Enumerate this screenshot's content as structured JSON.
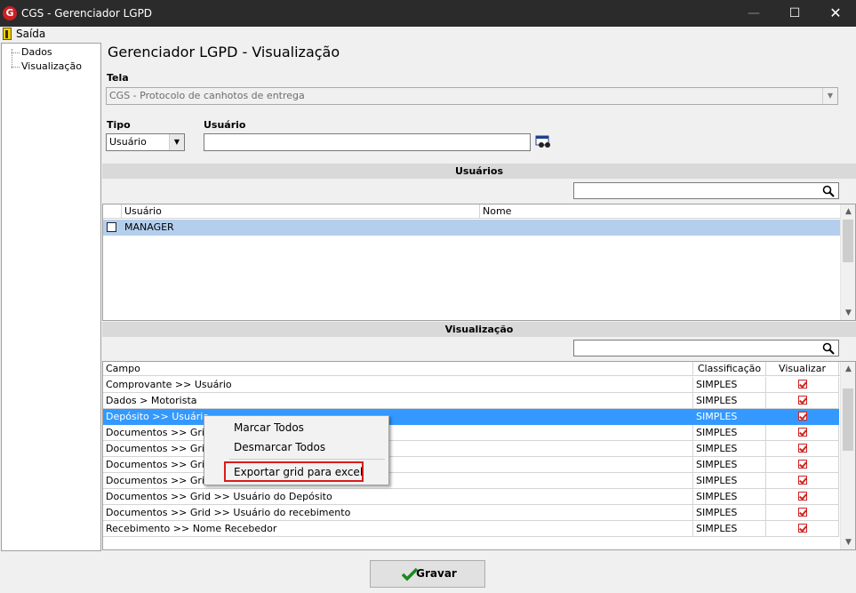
{
  "window": {
    "title": "CGS - Gerenciador LGPD",
    "app_icon_letter": "G",
    "minimize": "—",
    "maximize": "☐",
    "close": "✕"
  },
  "menu": {
    "saida": "Saída"
  },
  "tree": {
    "items": [
      "Dados",
      "Visualização"
    ]
  },
  "page_title": "Gerenciador LGPD - Visualização",
  "tela": {
    "label": "Tela",
    "value": "CGS - Protocolo de canhotos de entrega"
  },
  "tipo": {
    "label": "Tipo",
    "value": "Usuário"
  },
  "usuario": {
    "label": "Usuário",
    "value": ""
  },
  "usuarios_section": {
    "header": "Usuários",
    "search_value": "",
    "columns": [
      "Usuário",
      "Nome"
    ],
    "rows": [
      {
        "usuario": "MANAGER",
        "nome": ""
      }
    ]
  },
  "visualizacao_section": {
    "header": "Visualização",
    "search_value": "",
    "columns": [
      "Campo",
      "Classificação",
      "Visualizar"
    ],
    "rows": [
      {
        "campo": "Comprovante >> Usuário",
        "classificacao": "SIMPLES"
      },
      {
        "campo": "Dados > Motorista",
        "classificacao": "SIMPLES"
      },
      {
        "campo": "Depósito >> Usuário",
        "classificacao": "SIMPLES"
      },
      {
        "campo": "Documentos >> Grid >>",
        "classificacao": "SIMPLES"
      },
      {
        "campo": "Documentos >> Grid >>",
        "classificacao": "SIMPLES"
      },
      {
        "campo": "Documentos >> Grid >>",
        "classificacao": "SIMPLES"
      },
      {
        "campo": "Documentos >> Grid >>",
        "classificacao": "SIMPLES"
      },
      {
        "campo": "Documentos >> Grid >> Usuário do Depósito",
        "classificacao": "SIMPLES"
      },
      {
        "campo": "Documentos >> Grid >> Usuário do recebimento",
        "classificacao": "SIMPLES"
      },
      {
        "campo": "Recebimento >> Nome Recebedor",
        "classificacao": "SIMPLES"
      }
    ]
  },
  "context_menu": {
    "items": [
      "Marcar Todos",
      "Desmarcar Todos",
      "Exportar grid para excel"
    ]
  },
  "save_button": {
    "label": "Gravar"
  },
  "colors": {
    "selection": "#3399ff",
    "highlight_box": "#d91c1c",
    "titlebar": "#2b2b2b"
  }
}
